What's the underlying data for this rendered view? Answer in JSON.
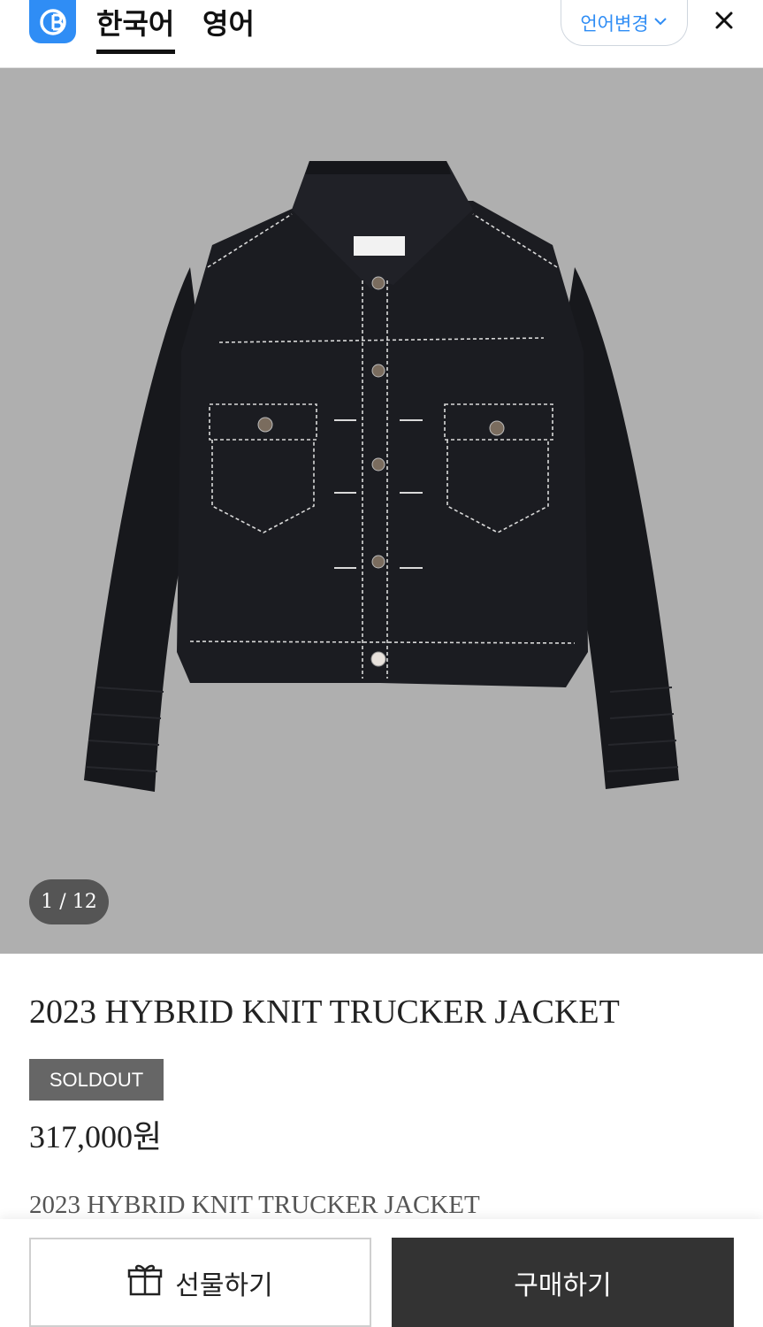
{
  "header": {
    "tabs": [
      {
        "label": "한국어",
        "active": true
      },
      {
        "label": "영어",
        "active": false
      }
    ],
    "language_change_label": "언어변경",
    "accent_color": "#2f8df5"
  },
  "icons": {
    "logo": "app-logo-icon",
    "chevron": "chevron-down-icon",
    "close": "close-icon",
    "gift": "gift-icon"
  },
  "gallery": {
    "indicator": "1 / 12",
    "current": 1,
    "total": 12
  },
  "product": {
    "title": "2023 HYBRID KNIT TRUCKER JACKET",
    "badge": "SOLDOUT",
    "price": "317,000원",
    "description": "2023 HYBRID KNIT TRUCKER JACKET"
  },
  "actions": {
    "gift_label": "선물하기",
    "buy_label": "구매하기"
  }
}
